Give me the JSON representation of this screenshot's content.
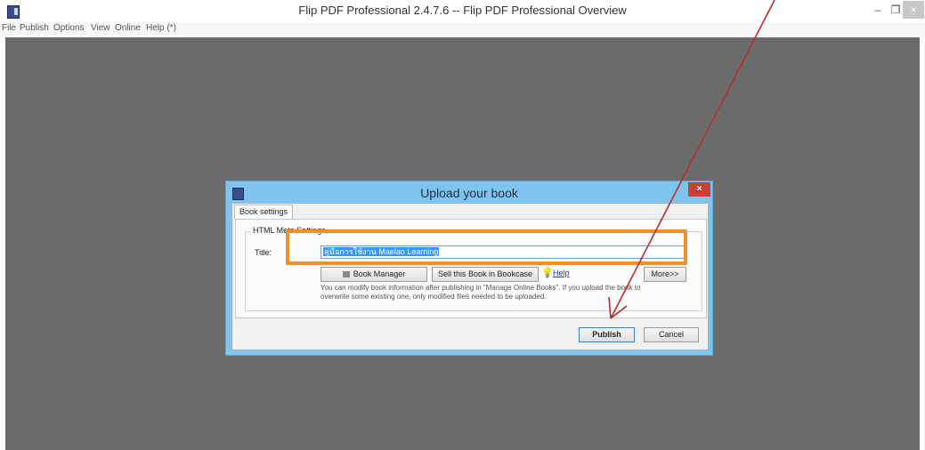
{
  "window": {
    "title": "Flip PDF Professional 2.4.7.6 -- Flip PDF Professional Overview",
    "controls": {
      "minimize": "–",
      "restore": "❐",
      "close": "×"
    }
  },
  "menu": [
    "File",
    "Publish",
    "Options",
    "View",
    "Online",
    "Help (*)"
  ],
  "dialog": {
    "title": "Upload your book",
    "close_glyph": "×",
    "tab": "Book settings",
    "group_legend": "HTML Meta Settings",
    "title_label": "Title:",
    "title_value": "คู่มือการใช้งาน Maelao Learning",
    "book_manager_label": "Book Manager",
    "sell_label": "Sell this Book in Bookcase",
    "help_label": "Help",
    "more_label": "More>>",
    "info_line1": "You can modify book information after publishing in \"Manage Online Books\". If you upload the book to",
    "info_line2": "overwrite some existing one, only modified files needed to be uploaded.",
    "publish_label": "Publish",
    "cancel_label": "Cancel"
  },
  "colors": {
    "workspace": "#6b6b6b",
    "dialog_frame": "#7ec4ee",
    "highlight": "#f0902c",
    "arrow": "#b5302a"
  },
  "icons": {
    "app": "flip-pdf-app-icon",
    "bulb": "lightbulb-icon",
    "book_manager": "book-manager-icon"
  }
}
